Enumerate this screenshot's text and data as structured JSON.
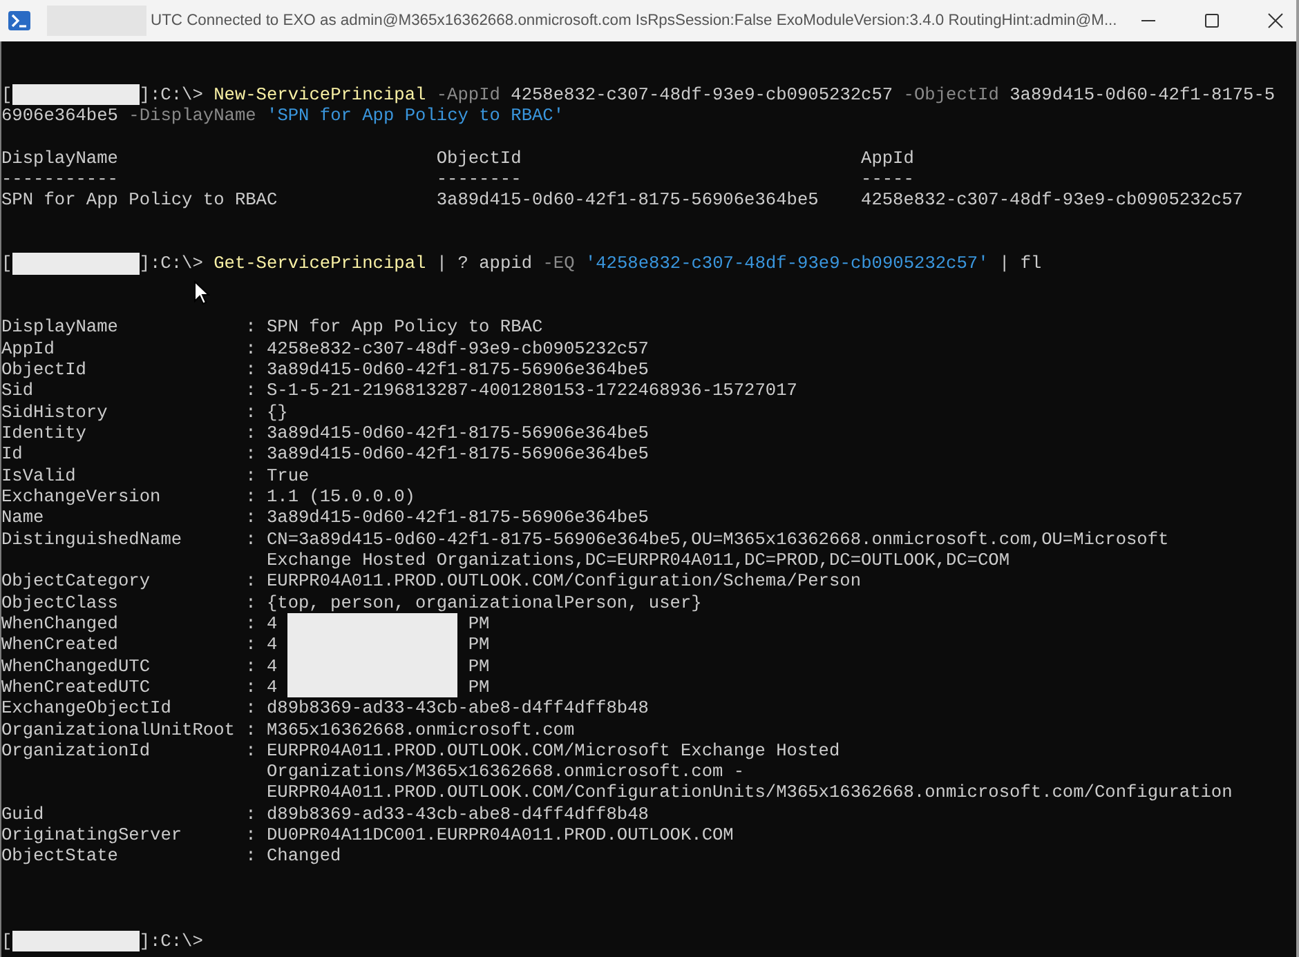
{
  "window": {
    "title": "UTC Connected to EXO as admin@M365x16362668.onmicrosoft.com IsRpsSession:False ExoModuleVersion:3.4.0 RoutingHint:admin@M...",
    "title_redacted": true
  },
  "window_controls": [
    {
      "kind": "minimize"
    },
    {
      "kind": "maximize"
    },
    {
      "kind": "close"
    }
  ],
  "console": {
    "blocks": [
      {
        "kind": "blank"
      },
      {
        "kind": "blank"
      },
      {
        "kind": "prompt",
        "prompt_open": "[",
        "redacted": true,
        "prompt_close": "]:C:\\>",
        "lines": [
          [
            {
              "kind": "cmd",
              "text": "New-ServicePrincipal"
            },
            {
              "kind": "param",
              "text": "-AppId"
            },
            {
              "kind": "arg",
              "text": "4258e832-c307-48df-93e9-cb0905232c57"
            },
            {
              "kind": "param",
              "text": "-ObjectId"
            },
            {
              "kind": "arg",
              "text": "3a89d415-0d60-42f1-8175-5"
            }
          ],
          [
            {
              "kind": "arg",
              "text": "6906e364be5"
            },
            {
              "kind": "param",
              "text": "-DisplayName"
            },
            {
              "kind": "str",
              "text": "'SPN for App Policy to RBAC'"
            }
          ]
        ]
      },
      {
        "kind": "blank"
      },
      {
        "kind": "table",
        "columns": [
          "DisplayName",
          "ObjectId",
          "AppId"
        ],
        "rules": [
          "-----------",
          "--------",
          "-----"
        ],
        "rows": [
          [
            "SPN for App Policy to RBAC",
            "3a89d415-0d60-42f1-8175-56906e364be5",
            "4258e832-c307-48df-93e9-cb0905232c57"
          ]
        ]
      },
      {
        "kind": "blank"
      },
      {
        "kind": "blank"
      },
      {
        "kind": "prompt",
        "prompt_open": "[",
        "redacted": true,
        "prompt_close": "]:C:\\>",
        "lines": [
          [
            {
              "kind": "cmd",
              "text": "Get-ServicePrincipal"
            },
            {
              "kind": "op",
              "text": "|"
            },
            {
              "kind": "op",
              "text": "?"
            },
            {
              "kind": "arg",
              "text": "appid"
            },
            {
              "kind": "param",
              "text": "-EQ"
            },
            {
              "kind": "str",
              "text": "'4258e832-c307-48df-93e9-cb0905232c57'"
            },
            {
              "kind": "op",
              "text": "|"
            },
            {
              "kind": "arg",
              "text": "fl"
            }
          ]
        ]
      },
      {
        "kind": "blank"
      },
      {
        "kind": "blank"
      },
      {
        "kind": "properties",
        "items": [
          {
            "key": "DisplayName",
            "sep": ":",
            "value": [
              "SPN for App Policy to RBAC"
            ]
          },
          {
            "key": "AppId",
            "sep": ":",
            "value": [
              "4258e832-c307-48df-93e9-cb0905232c57"
            ]
          },
          {
            "key": "ObjectId",
            "sep": ":",
            "value": [
              "3a89d415-0d60-42f1-8175-56906e364be5"
            ]
          },
          {
            "key": "Sid",
            "sep": ":",
            "value": [
              "S-1-5-21-2196813287-4001280153-1722468936-15727017"
            ]
          },
          {
            "key": "SidHistory",
            "sep": ":",
            "value": [
              "{}"
            ]
          },
          {
            "key": "Identity",
            "sep": ":",
            "value": [
              "3a89d415-0d60-42f1-8175-56906e364be5"
            ]
          },
          {
            "key": "Id",
            "sep": ":",
            "value": [
              "3a89d415-0d60-42f1-8175-56906e364be5"
            ]
          },
          {
            "key": "IsValid",
            "sep": ":",
            "value": [
              "True"
            ]
          },
          {
            "key": "ExchangeVersion",
            "sep": ":",
            "value": [
              "1.1 (15.0.0.0)"
            ]
          },
          {
            "key": "Name",
            "sep": ":",
            "value": [
              "3a89d415-0d60-42f1-8175-56906e364be5"
            ]
          },
          {
            "key": "DistinguishedName",
            "sep": ":",
            "value": [
              "CN=3a89d415-0d60-42f1-8175-56906e364be5,OU=M365x16362668.onmicrosoft.com,OU=Microsoft",
              "Exchange Hosted Organizations,DC=EURPR04A011,DC=PROD,DC=OUTLOOK,DC=COM"
            ]
          },
          {
            "key": "ObjectCategory",
            "sep": ":",
            "value": [
              "EURPR04A011.PROD.OUTLOOK.COM/Configuration/Schema/Person"
            ]
          },
          {
            "key": "ObjectClass",
            "sep": ":",
            "value": [
              "{top, person, organizationalPerson, user}"
            ]
          },
          {
            "key": "WhenChanged",
            "sep": ":",
            "value_start": "4",
            "redacted": true,
            "value_end": "PM"
          },
          {
            "key": "WhenCreated",
            "sep": ":",
            "value_start": "4",
            "redacted": true,
            "value_end": "PM"
          },
          {
            "key": "WhenChangedUTC",
            "sep": ":",
            "value_start": "4",
            "redacted": true,
            "value_end": "PM"
          },
          {
            "key": "WhenCreatedUTC",
            "sep": ":",
            "value_start": "4",
            "redacted": true,
            "value_end": "PM"
          },
          {
            "key": "ExchangeObjectId",
            "sep": ":",
            "value": [
              "d89b8369-ad33-43cb-abe8-d4ff4dff8b48"
            ]
          },
          {
            "key": "OrganizationalUnitRoot",
            "sep": ":",
            "value": [
              "M365x16362668.onmicrosoft.com"
            ]
          },
          {
            "key": "OrganizationId",
            "sep": ":",
            "value": [
              "EURPR04A011.PROD.OUTLOOK.COM/Microsoft Exchange Hosted",
              "Organizations/M365x16362668.onmicrosoft.com -",
              "EURPR04A011.PROD.OUTLOOK.COM/ConfigurationUnits/M365x16362668.onmicrosoft.com/Configuration"
            ]
          },
          {
            "key": "Guid",
            "sep": ":",
            "value": [
              "d89b8369-ad33-43cb-abe8-d4ff4dff8b48"
            ]
          },
          {
            "key": "OriginatingServer",
            "sep": ":",
            "value": [
              "DU0PR04A11DC001.EURPR04A011.PROD.OUTLOOK.COM"
            ]
          },
          {
            "key": "ObjectState",
            "sep": ":",
            "value": [
              "Changed"
            ]
          }
        ]
      },
      {
        "kind": "blank"
      },
      {
        "kind": "blank"
      },
      {
        "kind": "blank"
      },
      {
        "kind": "prompt",
        "prompt_open": "[",
        "redacted": true,
        "prompt_close": "]:C:\\>"
      }
    ]
  }
}
